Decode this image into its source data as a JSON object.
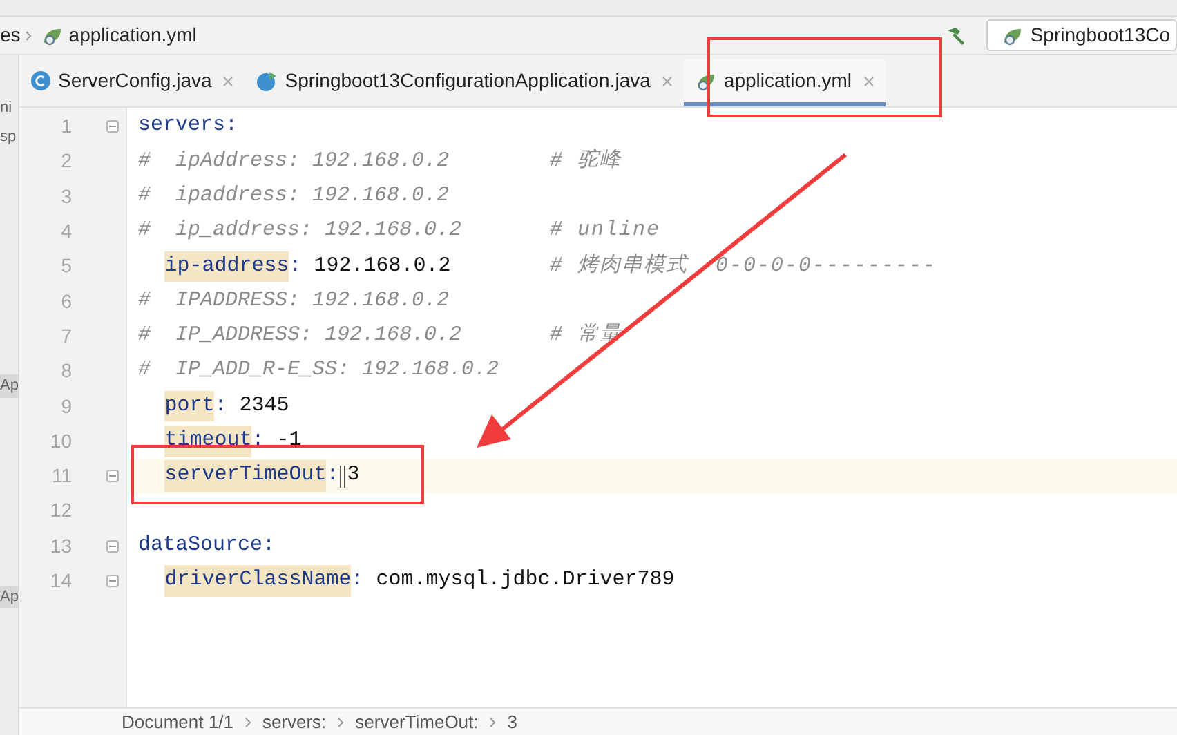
{
  "breadcrumb": {
    "items": [
      {
        "label": "es",
        "kind": "folder"
      },
      {
        "label": "application.yml",
        "kind": "yaml"
      }
    ]
  },
  "run_config": {
    "label": "Springboot13Co"
  },
  "left_panel": {
    "fragments": [
      "ni",
      "sp",
      "Ap",
      "Ap"
    ]
  },
  "tabs": [
    {
      "label": "ServerConfig.java",
      "kind": "class",
      "selected": false
    },
    {
      "label": "Springboot13ConfigurationApplication.java",
      "kind": "app",
      "selected": false
    },
    {
      "label": "application.yml",
      "kind": "yaml",
      "selected": true
    }
  ],
  "editor": {
    "lines": [
      {
        "number": "1",
        "kind": "key",
        "key": "servers",
        "colon": ":",
        "highlighted": false,
        "current": false,
        "fold": true,
        "cursor": false,
        "children": [
          {
            "number": "2",
            "kind": "comment",
            "text": "#  ipAddress: 192.168.0.2",
            "comment": "# 驼峰",
            "current": false,
            "fold": false
          },
          {
            "number": "3",
            "kind": "comment",
            "text": "#  ipaddress: 192.168.0.2",
            "current": false,
            "fold": false
          },
          {
            "number": "4",
            "kind": "comment",
            "text": "#  ip_address: 192.168.0.2",
            "comment": "# unline",
            "current": false,
            "fold": false
          },
          {
            "number": "5",
            "kind": "key",
            "key": "ip-address",
            "colon": ":",
            "value": "192.168.0.2",
            "comment": "# 烤肉串模式  0-0-0-0---------",
            "highlighted": true,
            "current": false,
            "fold": false,
            "cursor": false
          },
          {
            "number": "6",
            "kind": "comment",
            "text": "#  IPADDRESS: 192.168.0.2",
            "current": false,
            "fold": false
          },
          {
            "number": "7",
            "kind": "comment",
            "text": "#  IP_ADDRESS: 192.168.0.2",
            "comment": "# 常量",
            "current": false,
            "fold": false
          },
          {
            "number": "8",
            "kind": "comment",
            "text": "#  IP_ADD_R-E_SS: 192.168.0.2",
            "current": false,
            "fold": false
          },
          {
            "number": "9",
            "kind": "key",
            "key": "port",
            "colon": ":",
            "value": "2345",
            "highlighted": true,
            "current": false,
            "fold": false,
            "cursor": false
          },
          {
            "number": "10",
            "kind": "key",
            "key": "timeout",
            "colon": ":",
            "value": "-1",
            "highlighted": true,
            "current": false,
            "fold": false,
            "cursor": false
          },
          {
            "number": "11",
            "kind": "key",
            "key": "serverTimeOut",
            "colon": ":",
            "value": "3",
            "highlighted": true,
            "current": true,
            "fold": true,
            "cursor": true
          },
          {
            "number": "12",
            "kind": "blank",
            "current": false,
            "fold": false
          }
        ]
      },
      {
        "number": "13",
        "kind": "key",
        "key": "dataSource",
        "colon": ":",
        "highlighted": false,
        "current": false,
        "fold": true,
        "cursor": false,
        "children": [
          {
            "number": "14",
            "kind": "key",
            "key": "driverClassName",
            "colon": ":",
            "value": "com.mysql.jdbc.Driver789",
            "highlighted": true,
            "current": false,
            "fold": true,
            "cursor": false
          }
        ]
      }
    ]
  },
  "status_bar": {
    "items": [
      "Document 1/1",
      "servers:",
      "serverTimeOut:",
      "3"
    ]
  }
}
